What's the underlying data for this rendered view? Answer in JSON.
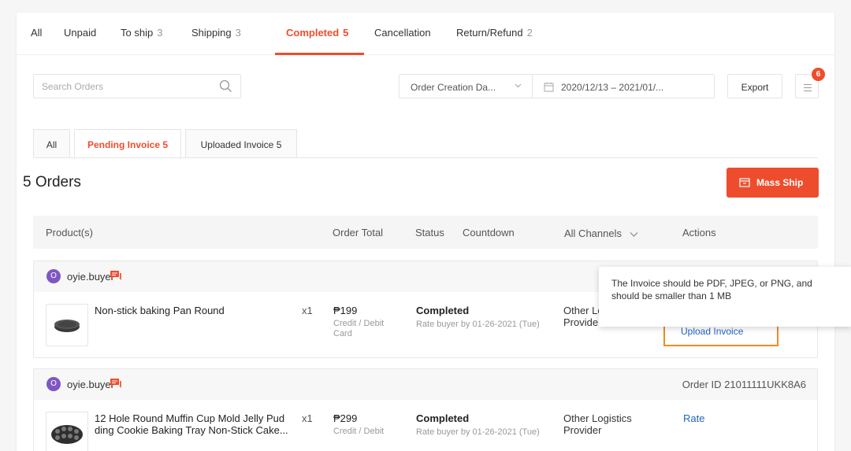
{
  "tabs": [
    {
      "label": "All",
      "count": ""
    },
    {
      "label": "Unpaid",
      "count": ""
    },
    {
      "label": "To ship",
      "count": "3"
    },
    {
      "label": "Shipping",
      "count": "3"
    },
    {
      "label": "Completed",
      "count": "5"
    },
    {
      "label": "Cancellation",
      "count": ""
    },
    {
      "label": "Return/Refund",
      "count": "2"
    }
  ],
  "filters": {
    "search_placeholder": "Search Orders",
    "date_type": "Order Creation Da...",
    "date_range": "2020/12/13 – 2021/01/...",
    "export_label": "Export",
    "menu_badge": "6"
  },
  "subtabs": [
    {
      "label": "All"
    },
    {
      "label": "Pending Invoice 5"
    },
    {
      "label": "Uploaded Invoice 5"
    }
  ],
  "orders_title": "5 Orders",
  "mass_ship_label": "Mass Ship",
  "table_header": {
    "product": "Product(s)",
    "order_total": "Order Total",
    "status": "Status",
    "countdown": "Countdown",
    "channels": "All Channels",
    "actions": "Actions"
  },
  "orders": [
    {
      "avatar": "O",
      "buyer": "oyie.buyer",
      "order_id": "",
      "product": "Non-stick baking Pan Round",
      "product_line2": "",
      "qty": "x1",
      "price": "₱199",
      "payment_l1": "Credit / Debit",
      "payment_l2": "Card",
      "status": "Completed",
      "rate_by": "Rate buyer by 01-26-2021 (Tue)",
      "channel_l1": "Other Lo",
      "channel_l2": "Provider",
      "action": "Upload Invoice"
    },
    {
      "avatar": "O",
      "buyer": "oyie.buyer",
      "order_id": "Order ID 21011111UKK8A6",
      "product": "12 Hole Round Muffin Cup Mold Jelly Pud",
      "product_line2": "ding Cookie Baking Tray Non-Stick Cake...",
      "qty": "x1",
      "price": "₱299",
      "payment_l1": "Credit / Debit",
      "payment_l2": "",
      "status": "Completed",
      "rate_by": "Rate buyer by 01-26-2021 (Tue)",
      "channel_l1": "Other Logistics",
      "channel_l2": "Provider",
      "action": "Rate"
    }
  ],
  "tooltip": {
    "line1": "The Invoice should be PDF, JPEG, or PNG, and",
    "line2": "should be smaller than 1 MB"
  },
  "colors": {
    "accent": "#ee4d2d",
    "link": "#1f63c4",
    "highlight": "#f08a24"
  }
}
